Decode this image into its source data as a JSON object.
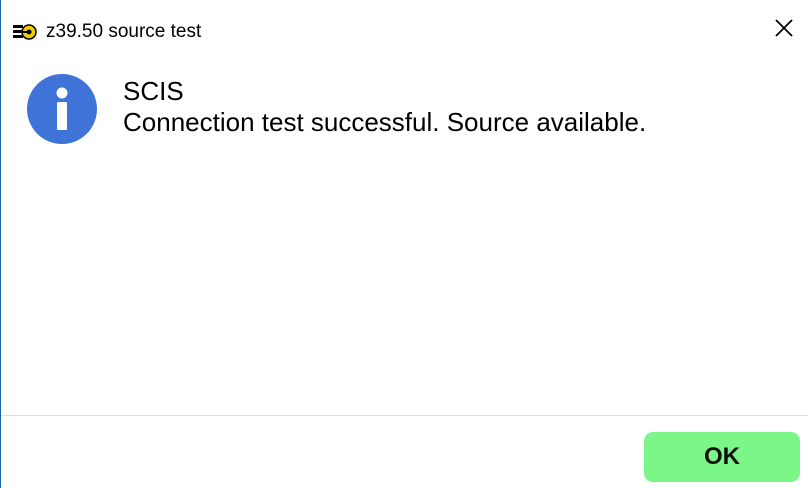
{
  "window": {
    "title": "z39.50 source test",
    "app_icon": "yellow-key-app-icon",
    "close_icon": "close-icon"
  },
  "message": {
    "icon": "info-icon",
    "icon_color": "#3f73d8",
    "title": "SCIS",
    "body": "Connection test successful. Source available."
  },
  "footer": {
    "ok_label": "OK",
    "ok_color": "#7cf589"
  }
}
